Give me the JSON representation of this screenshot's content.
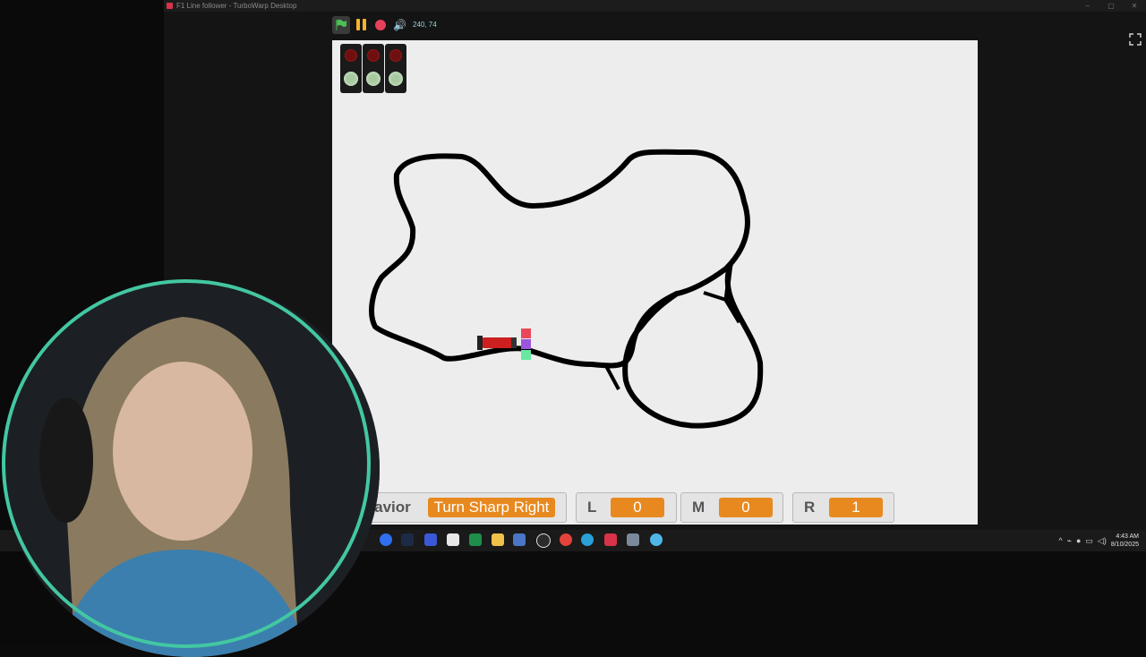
{
  "window": {
    "title": "F1 Line follower - TurboWarp Desktop",
    "controls": [
      "–",
      "▢",
      "✕"
    ]
  },
  "toolbar": {
    "coordinates": "240, 74",
    "icons": [
      "green-flag-icon",
      "pause-icon",
      "stop-icon",
      "sound-icon",
      "fullscreen-icon"
    ],
    "accent_green": "#4cbf56",
    "accent_pause": "#f7b32b",
    "accent_stop": "#e6405a"
  },
  "stage": {
    "background": "#ededed",
    "traffic_lights": [
      "red-green",
      "red-green",
      "red-green"
    ],
    "sensor_colors": [
      "#e8485a",
      "#9b56dc",
      "#66e8a0"
    ]
  },
  "monitors": {
    "behavior": {
      "label": "Behavior",
      "value": "Turn Sharp Right"
    },
    "left": {
      "label": "L",
      "value": "0"
    },
    "middle": {
      "label": "M",
      "value": "0"
    },
    "right": {
      "label": "R",
      "value": "1"
    },
    "value_color": "#e8891f"
  },
  "taskbar": {
    "icons": [
      "spotify-icon",
      "messenger-icon",
      "steam-icon",
      "app-icon",
      "notepad-icon",
      "excel-icon",
      "file-explorer-icon",
      "task-manager-icon",
      "obs-icon",
      "chrome-icon",
      "edge-icon",
      "turbowarp-icon",
      "calculator-icon",
      "chrome-beta-icon"
    ],
    "tray_icons": [
      "chevron-up-icon",
      "network-icon",
      "mic-icon",
      "monitor-icon",
      "volume-icon"
    ],
    "time": "4:43 AM",
    "date": "8/10/2025"
  },
  "webcam": {
    "ring_color": "#43c7a2"
  }
}
